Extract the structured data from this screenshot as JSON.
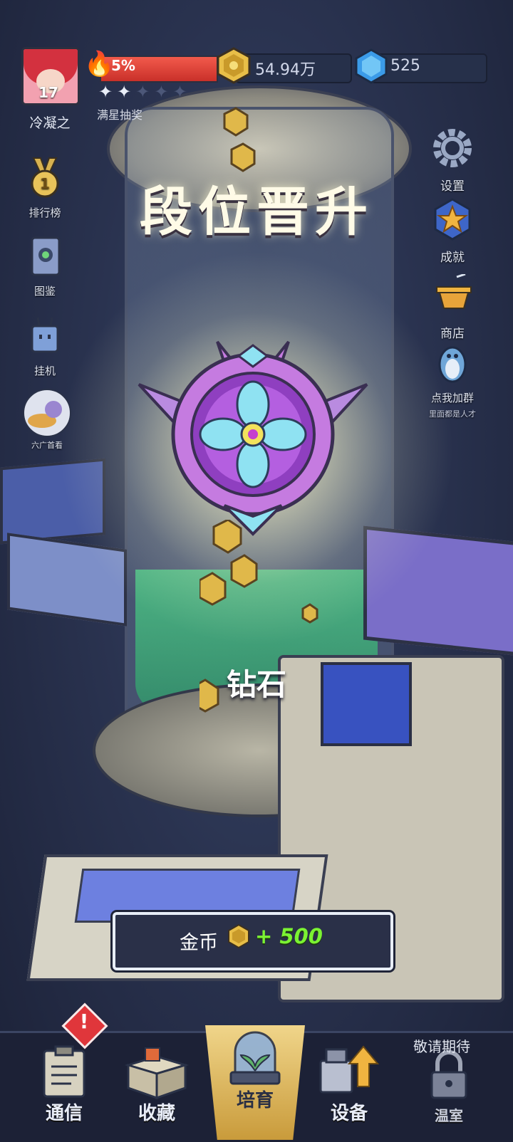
{
  "player": {
    "level": "17",
    "name": "冷凝之"
  },
  "star_progress": {
    "percent_label": "5%",
    "progress": 0.05,
    "stars_filled": 2,
    "stars_total": 5,
    "label": "满星抽奖"
  },
  "currency": {
    "coins": "54.94万",
    "gems": "525",
    "coin_icon": "hex-coin-icon",
    "gem_icon": "blue-gem-icon"
  },
  "left_menu": [
    {
      "label": "排行榜",
      "icon": "medal-icon"
    },
    {
      "label": "图鉴",
      "icon": "book-icon"
    },
    {
      "label": "挂机",
      "icon": "robot-icon"
    },
    {
      "label": "六广首看",
      "icon": "ad-bonus-icon"
    }
  ],
  "right_menu": [
    {
      "label": "设置",
      "icon": "gear-icon"
    },
    {
      "label": "成就",
      "icon": "star-badge-icon"
    },
    {
      "label": "商店",
      "icon": "basket-icon"
    },
    {
      "label": "点我加群",
      "sub": "里面都是人才",
      "icon": "penguin-icon"
    }
  ],
  "popup": {
    "title": "段位晋升",
    "rank_name": "钻石",
    "reward_label": "金币",
    "reward_amount": "+ 500"
  },
  "bottom_nav": [
    {
      "label": "通信",
      "icon": "clipboard-icon",
      "alert": "!"
    },
    {
      "label": "收藏",
      "icon": "box-icon"
    },
    {
      "label": "培育",
      "icon": "plant-dome-icon",
      "active": true
    },
    {
      "label": "设备",
      "icon": "upgrade-device-icon"
    },
    {
      "label": "温室",
      "icon": "lock-icon",
      "note": "敬请期待"
    }
  ],
  "colors": {
    "accent_green": "#7bf332",
    "star_bar_red": "#e8443a",
    "nav_active_gold": "#e6c36b",
    "badge_purple": "#c57be0"
  }
}
